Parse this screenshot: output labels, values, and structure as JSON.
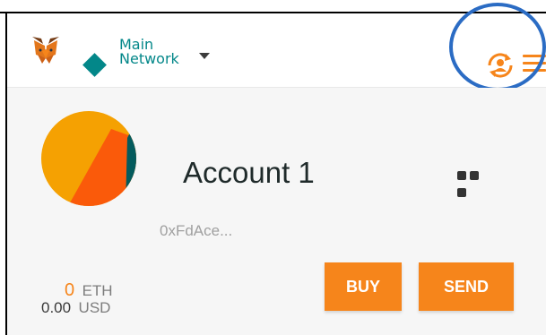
{
  "header": {
    "network_name_line1": "Main",
    "network_name_line2": "Network",
    "network_color": "#038789"
  },
  "account": {
    "name": "Account 1",
    "address": "0xFdAce..."
  },
  "balance": {
    "eth_amount": "0",
    "eth_unit": "ETH",
    "usd_amount": "0.00",
    "usd_unit": "USD"
  },
  "actions": {
    "buy_label": "BUY",
    "send_label": "SEND"
  },
  "colors": {
    "accent": "#f6851b",
    "teal": "#038789",
    "highlight_ring": "#2b6cc4"
  },
  "icons": {
    "logo": "metamask-fox-icon",
    "network": "network-diamond-icon",
    "account_switch": "account-switch-icon",
    "menu": "hamburger-menu-icon",
    "more": "more-options-icon"
  }
}
